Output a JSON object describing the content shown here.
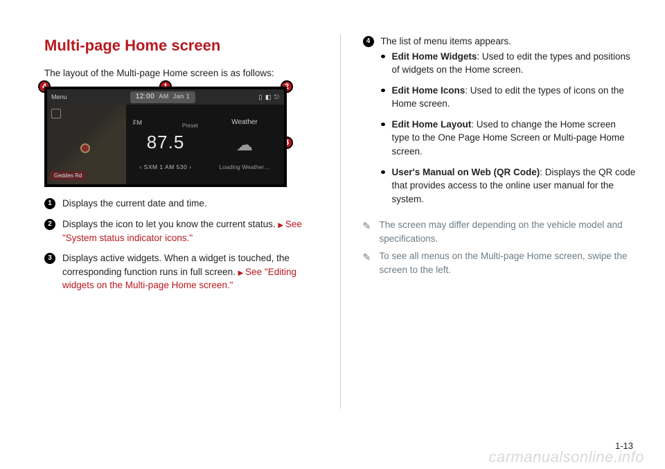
{
  "heading": "Multi-page Home screen",
  "intro": "The layout of the Multi-page Home screen is as follows:",
  "screenshot": {
    "menu_label": "Menu",
    "clock_time": "12:00",
    "clock_ampm": "AM",
    "clock_date": "Jan 1",
    "map_road": "Geddes Rd",
    "radio_band": "FM",
    "radio_preset": "Preset",
    "radio_freq": "87.5",
    "radio_tuner": "‹   SXM 1     AM 530   ›",
    "weather_title": "Weather",
    "weather_loading": "Loading Weather…"
  },
  "callouts": {
    "c1": "Displays the current date and time.",
    "c2": "Displays the icon to let you know the current status.",
    "c2_link": "See \"System status indicator icons.\"",
    "c3": "Displays active widgets. When a widget is touched, the corresponding function runs in full screen.",
    "c3_link": "See \"Editing widgets on the Multi-page Home screen.\"",
    "c4": "The list of menu items appears."
  },
  "menu_items": {
    "i1_b": "Edit Home Widgets",
    "i1_t": ": Used to edit the types and positions of widgets on the Home screen.",
    "i2_b": "Edit Home Icons",
    "i2_t": ": Used to edit the types of icons on the Home screen.",
    "i3_b": "Edit Home Layout",
    "i3_t": ": Used to change the Home screen type to the One Page Home Screen or Multi-page Home screen.",
    "i4_b": "User's Manual on Web (QR Code)",
    "i4_t": ": Displays the QR code that provides access to the online user manual for the system."
  },
  "notes": {
    "n1": "The screen may differ depending on the vehicle model and specifications.",
    "n2": "To see all menus on the Multi-page Home screen, swipe the screen to the left."
  },
  "page_number": "1-13",
  "watermark": "carmanualsonline.info"
}
